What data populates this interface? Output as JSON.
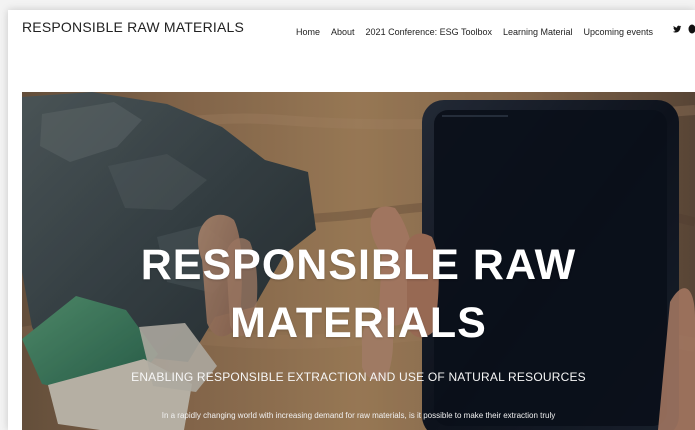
{
  "header": {
    "brand": "RESPONSIBLE RAW MATERIALS",
    "nav_items": [
      "Home",
      "About",
      "2021 Conference: ESG Toolbox",
      "Learning Material",
      "Upcoming events"
    ],
    "social_icons": [
      "twitter-icon",
      "circle-icon"
    ]
  },
  "hero": {
    "title_line_1": "RESPONSIBLE RAW",
    "title_line_2": "MATERIALS",
    "subtitle": "ENABLING RESPONSIBLE EXTRACTION AND USE OF NATURAL RESOURCES",
    "body_text": "In a rapidly changing world with increasing demand for raw materials, is it possible to make their extraction truly"
  },
  "colors": {
    "page_background": "#f3f3f3",
    "panel_background": "#ffffff",
    "text_primary": "#222222",
    "hero_text": "#ffffff"
  }
}
